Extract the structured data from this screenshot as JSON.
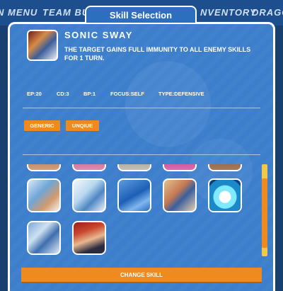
{
  "background_nav": {
    "items": [
      "N MENU",
      "TEAM BU",
      "NVENTORY",
      "DRAGO"
    ]
  },
  "modal": {
    "title": "Skill Selection"
  },
  "skill": {
    "name": "SONIC SWAY",
    "description": "THE TARGET GAINS FULL IMMUNITY TO ALL ENEMY SKILLS FOR 1 TURN.",
    "stats": {
      "ep": "EP:20",
      "cd": "CD:3",
      "bp": "BP:1",
      "focus": "FOCUS:SELF",
      "type": "TYPE:DEFENSIVE"
    }
  },
  "filters": {
    "generic": "GENERIC",
    "unique": "UNQIUE"
  },
  "actions": {
    "change_skill": "CHANGE SKILL"
  },
  "colors": {
    "accent": "#ef8a1f",
    "modal_bg": "#3d7fcc",
    "scroll_track": "#f2c84b"
  }
}
